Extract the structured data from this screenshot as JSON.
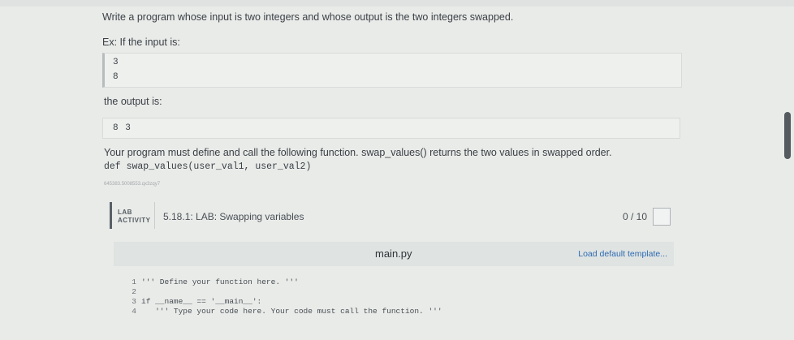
{
  "problem": {
    "statement": "Write a program whose input is two integers and whose output is the two integers swapped.",
    "example_intro": "Ex: If the input is:",
    "sample_input": [
      "3",
      "8"
    ],
    "output_intro": "the output is:",
    "sample_output": "8 3",
    "define_text": "Your program must define and call the following function. swap_values() returns the two values in swapped order.",
    "signature": "def swap_values(user_val1, user_val2)",
    "identifier": "645383.5008553.qx3zqy7"
  },
  "lab": {
    "badge_line1": "LAB",
    "badge_line2": "ACTIVITY",
    "title": "5.18.1: LAB: Swapping variables",
    "score": "0 / 10"
  },
  "editor": {
    "filename": "main.py",
    "load_template": "Load default template...",
    "lines": [
      {
        "num": "1",
        "code": "''' Define your function here. '''"
      },
      {
        "num": "2",
        "code": ""
      },
      {
        "num": "3",
        "code": "if __name__ == '__main__':"
      },
      {
        "num": "4",
        "code": "   ''' Type your code here. Your code must call the function. '''"
      }
    ]
  }
}
